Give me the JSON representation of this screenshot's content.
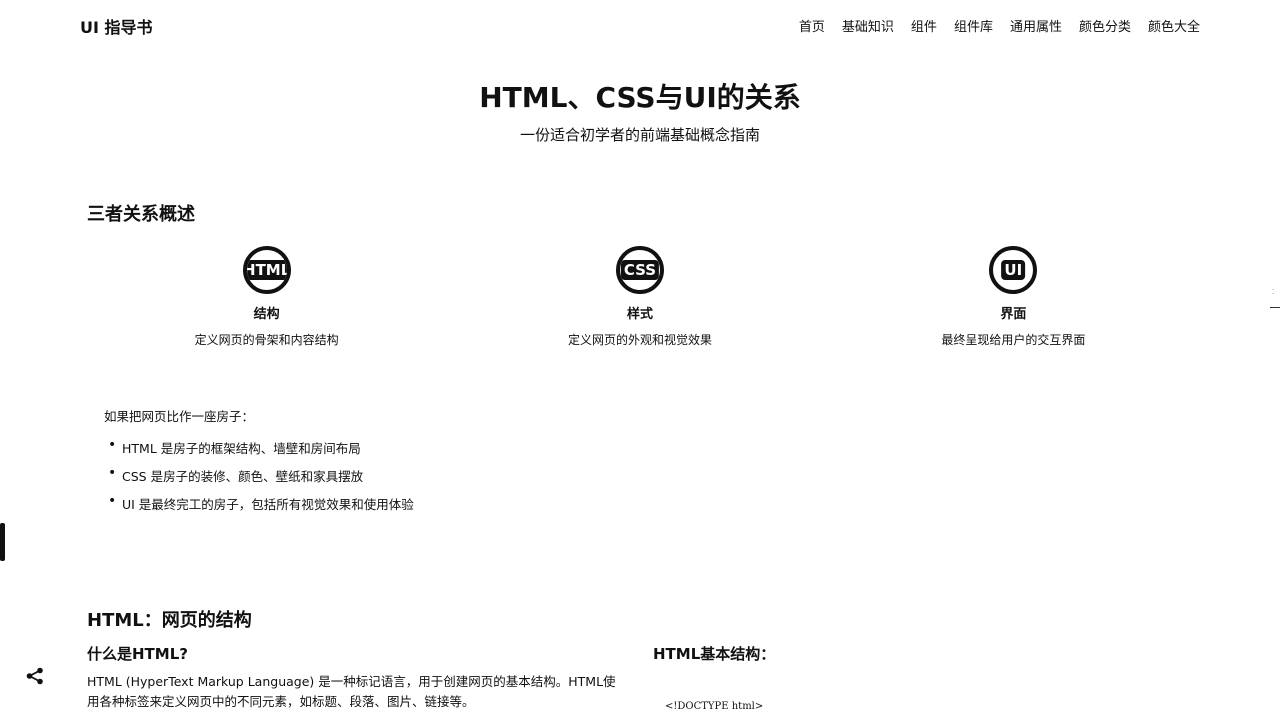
{
  "nav": {
    "logo": "UI 指导书",
    "links": [
      "首页",
      "基础知识",
      "组件",
      "组件库",
      "通用属性",
      "颜色分类",
      "颜色大全"
    ]
  },
  "hero": {
    "title": "HTML、CSS与UI的关系",
    "subtitle": "一份适合初学者的前端基础概念指南"
  },
  "overview": {
    "title": "三者关系概述",
    "cards": [
      {
        "icon_text": "HTML",
        "icon": "html-badge-icon",
        "title": "结构",
        "desc": "定义网页的骨架和内容结构"
      },
      {
        "icon_text": "CSS",
        "icon": "css-badge-icon",
        "title": "样式",
        "desc": "定义网页的外观和视觉效果"
      },
      {
        "icon_text": "UI",
        "icon": "ui-badge-icon",
        "title": "界面",
        "desc": "最终呈现给用户的交互界面"
      }
    ]
  },
  "analogy": {
    "intro": "如果把网页比作一座房子：",
    "items": [
      "HTML 是房子的框架结构、墙壁和房间布局",
      "CSS 是房子的装修、颜色、壁纸和家具摆放",
      "UI 是最终完工的房子，包括所有视觉效果和使用体验"
    ]
  },
  "html_section": {
    "title": "HTML：网页的结构",
    "what_is_title": "什么是HTML?",
    "what_is_text": "HTML (HyperText Markup Language) 是一种标记语言，用于创建网页的基本结构。HTML使用各种标签来定义网页中的不同元素，如标题、段落、图片、链接等。",
    "structure_title": "HTML基本结构：",
    "code_first_line": "<!DOCTYPE html>"
  },
  "icons": {
    "share": "share-icon"
  }
}
